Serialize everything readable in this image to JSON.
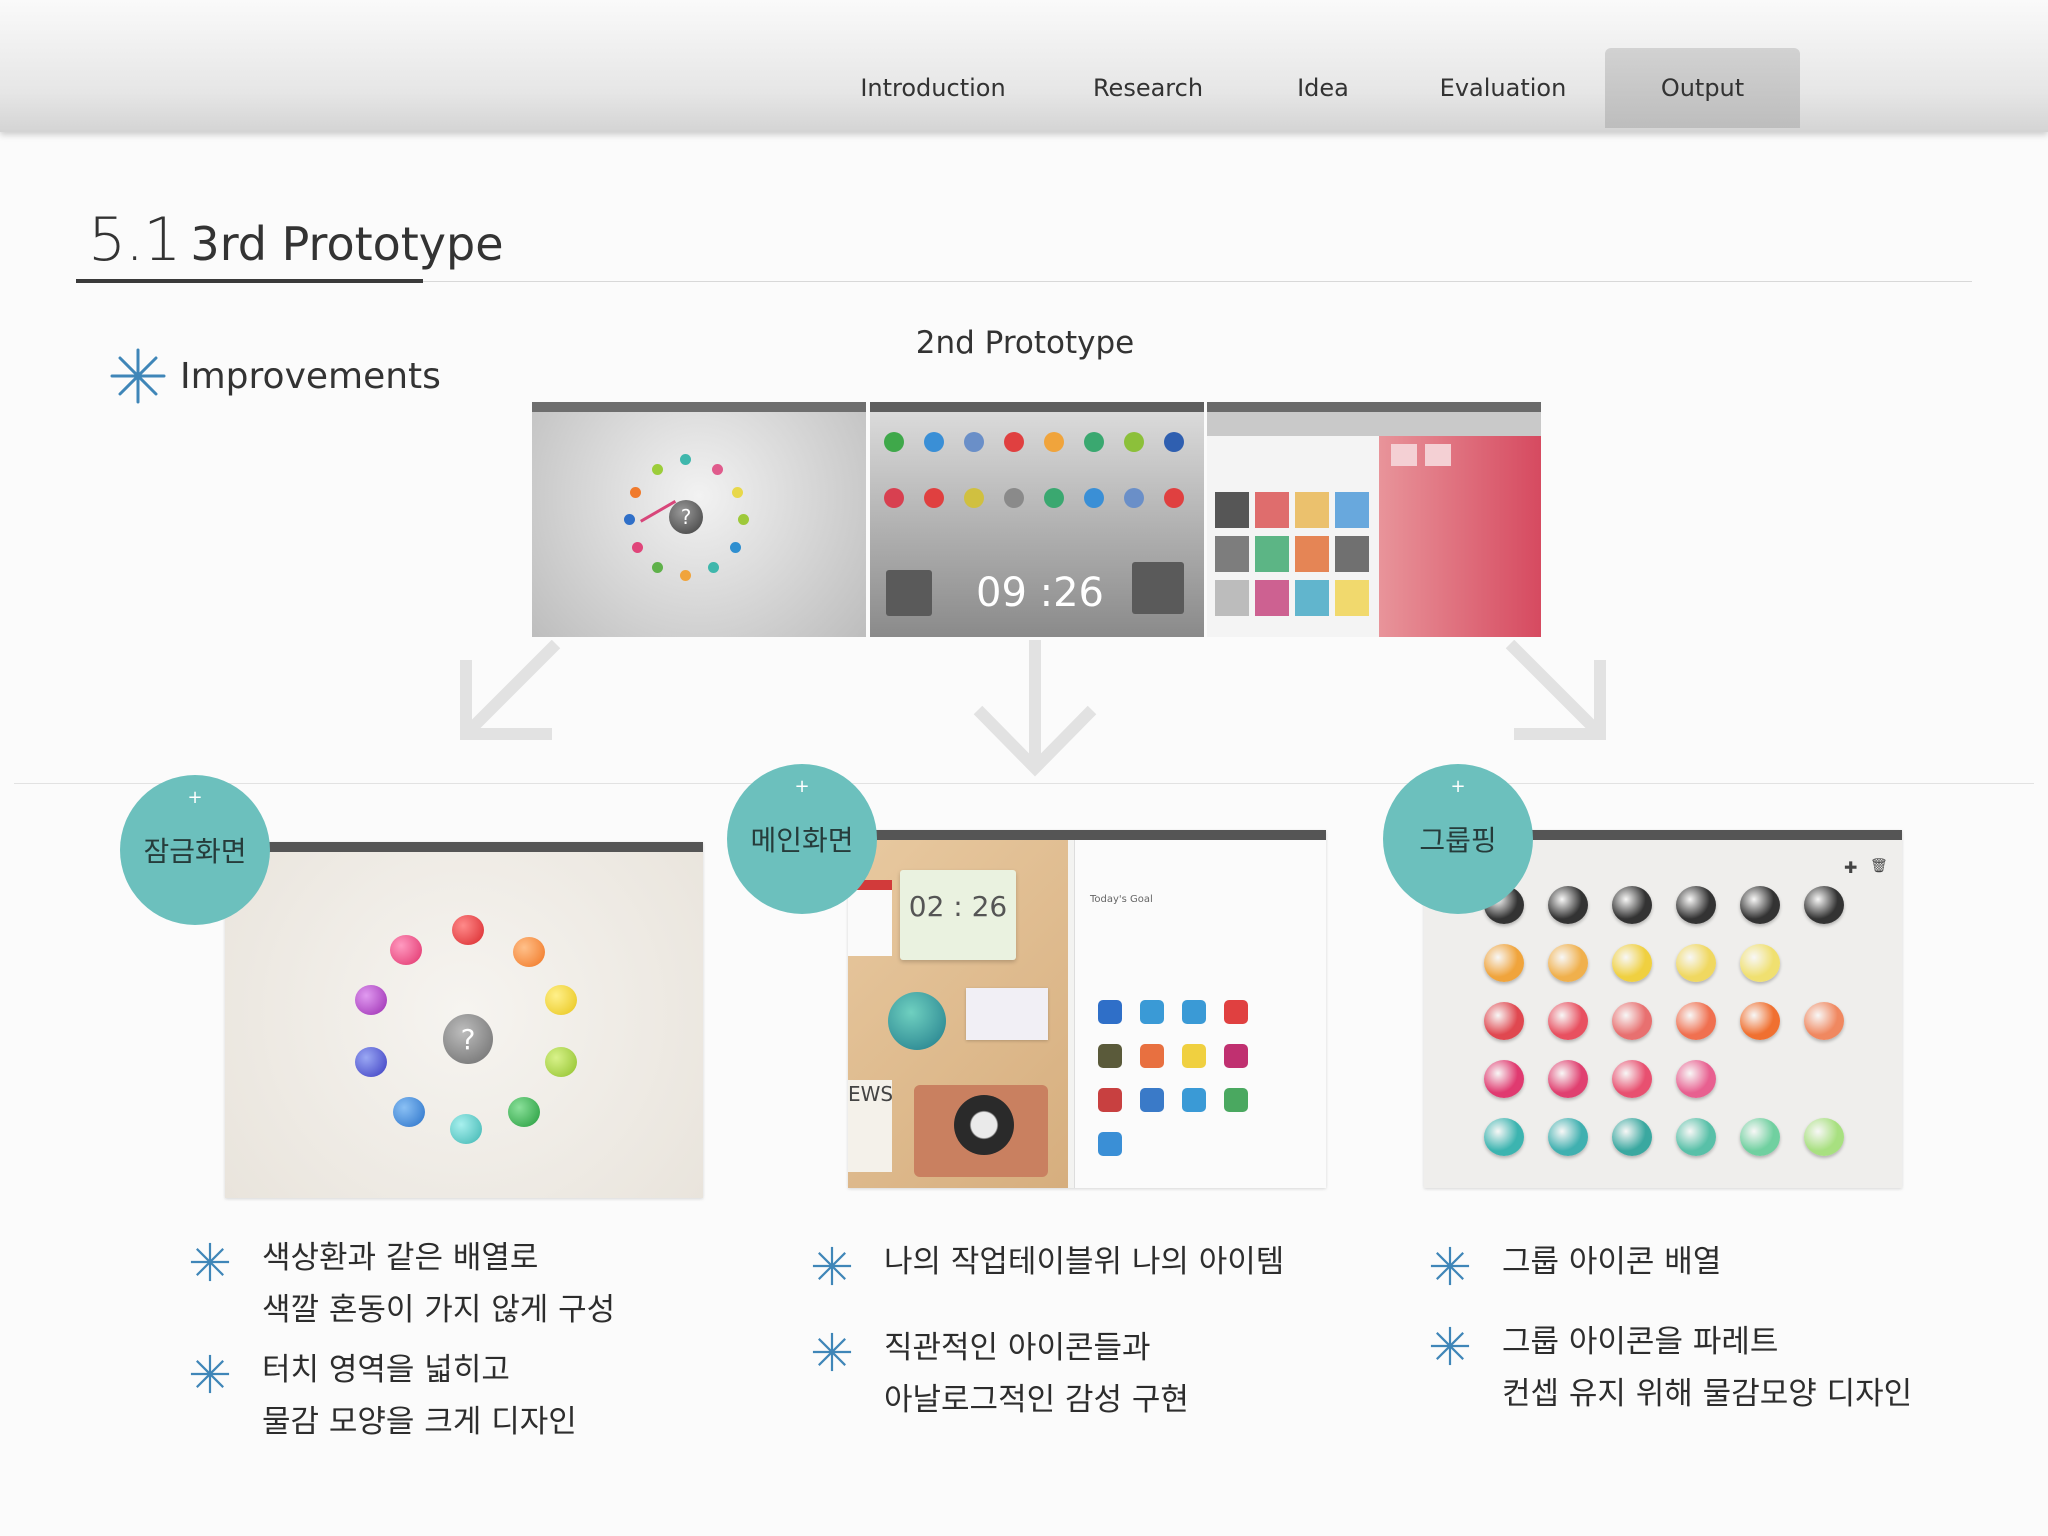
{
  "nav": {
    "items": [
      {
        "label": "Introduction"
      },
      {
        "label": "Research"
      },
      {
        "label": "Idea"
      },
      {
        "label": "Evaluation"
      },
      {
        "label": "Output",
        "active": true
      }
    ]
  },
  "heading": {
    "number": "5.1",
    "title": "3rd Prototype"
  },
  "improvements_label": "Improvements",
  "prototype2": {
    "title": "2nd Prototype",
    "clock": "09 :26",
    "lock_symbol": "?"
  },
  "sections": [
    {
      "badge": "잠금화면",
      "lock_symbol": "?",
      "bullets": [
        {
          "lines": [
            "색상환과 같은 배열로",
            "색깔 혼동이 가지 않게 구성"
          ]
        },
        {
          "lines": [
            "터치 영역을 넓히고",
            "물감 모양을 크게 디자인"
          ]
        }
      ]
    },
    {
      "badge": "메인화면",
      "clock": "02 : 26",
      "news_text": "EWS",
      "goal_title": "Today's Goal",
      "bullets": [
        {
          "lines": [
            "나의 작업테이블위 나의 아이템"
          ]
        },
        {
          "lines": [
            "직관적인 아이콘들과",
            "아날로그적인 감성 구현"
          ]
        }
      ]
    },
    {
      "badge": "그룹핑",
      "bullets": [
        {
          "lines": [
            "그룹 아이콘 배열"
          ]
        },
        {
          "lines": [
            "그룹 아이콘을 파레트",
            "컨셉 유지 위해 물감모양 디자인"
          ]
        }
      ]
    }
  ],
  "colors": {
    "accent_teal": "#6cc0bd",
    "asterisk_blue": "#3f86b8",
    "active_tab": "#c6c6c6",
    "arrow_gray": "#e0e0e0"
  }
}
